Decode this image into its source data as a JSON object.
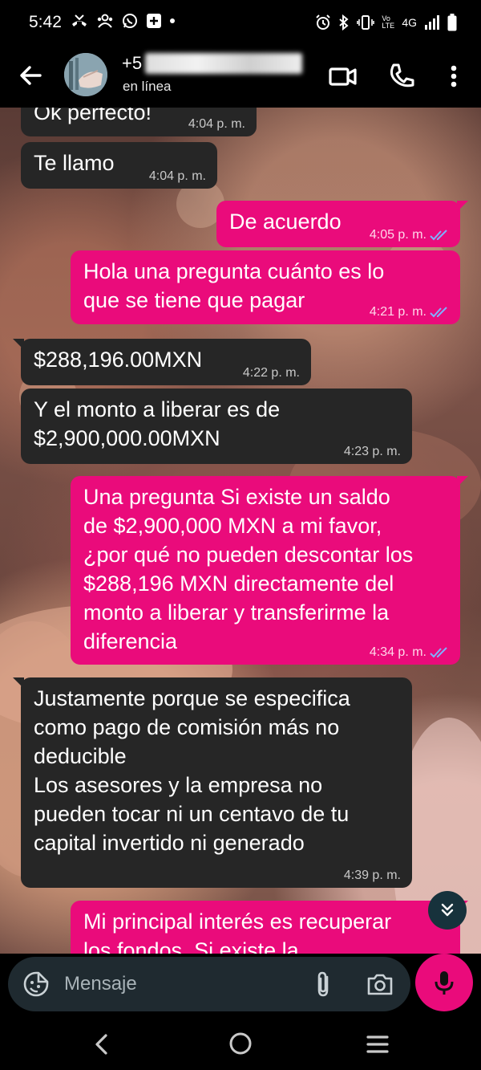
{
  "status_bar": {
    "time": "5:42",
    "network_label": "4G",
    "volte_label": "Vo LTE"
  },
  "header": {
    "contact_name_visible": "+5",
    "status": "en línea"
  },
  "messages": [
    {
      "direction": "in",
      "text": "Ok perfecto!",
      "time": "4:04 p. m."
    },
    {
      "direction": "in",
      "text": "Te llamo",
      "time": "4:04 p. m."
    },
    {
      "direction": "out",
      "text": "De acuerdo",
      "time": "4:05 p. m.",
      "read": true
    },
    {
      "direction": "out",
      "lines": [
        "Hola una pregunta cuánto es lo",
        "que se tiene que pagar"
      ],
      "time": "4:21 p. m.",
      "read": true
    },
    {
      "direction": "in",
      "text": "$288,196.00MXN",
      "time": "4:22 p. m."
    },
    {
      "direction": "in",
      "lines": [
        "Y el monto a liberar es de",
        "$2,900,000.00MXN"
      ],
      "time": "4:23 p. m."
    },
    {
      "direction": "out",
      "lines": [
        "Una pregunta Si existe un saldo",
        "de $2,900,000 MXN a mi favor,",
        "¿por qué no pueden descontar los",
        "$288,196 MXN directamente del",
        "monto a liberar y transferirme la",
        "diferencia"
      ],
      "time": "4:34 p. m.",
      "read": true
    },
    {
      "direction": "in",
      "lines": [
        "Justamente porque se especifica",
        "como pago de comisión más no",
        "deducible",
        "Los asesores y la empresa no",
        "pueden tocar ni un centavo de tu",
        "capital invertido ni generado"
      ],
      "time": "4:39 p. m."
    },
    {
      "direction": "out",
      "lines": [
        "Mi principal interés es recuperar",
        "los fondos. Si existe la"
      ]
    }
  ],
  "composer": {
    "placeholder": "Mensaje"
  },
  "colors": {
    "outgoing_bubble": "#ea0b7b",
    "incoming_bubble": "#262626",
    "read_ticks": "#7fb0ff"
  }
}
